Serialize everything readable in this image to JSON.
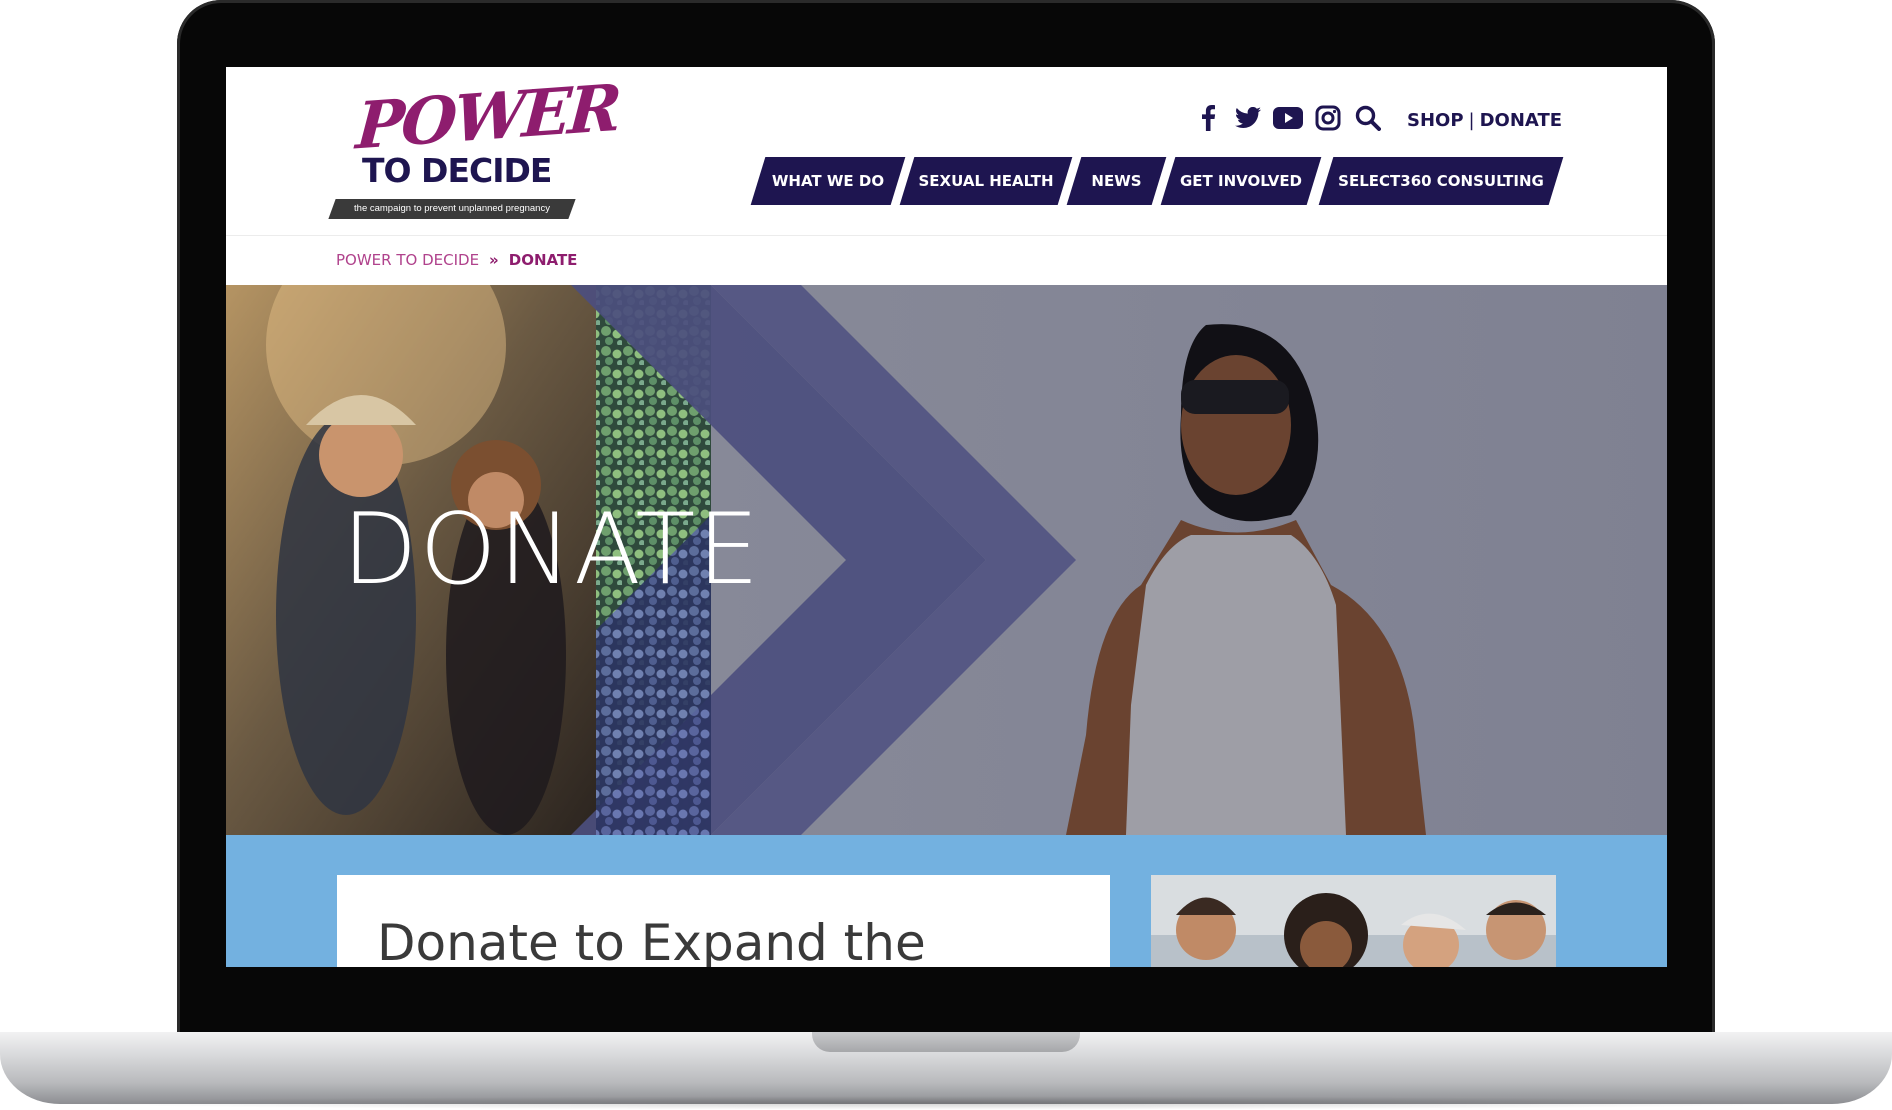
{
  "logo": {
    "word1": "POWER",
    "word2": "TO DECIDE",
    "tagline": "the campaign to prevent unplanned pregnancy"
  },
  "social": [
    {
      "icon": "facebook-icon"
    },
    {
      "icon": "twitter-icon"
    },
    {
      "icon": "youtube-icon"
    },
    {
      "icon": "instagram-icon"
    },
    {
      "icon": "search-icon"
    }
  ],
  "utility": {
    "shop": "SHOP",
    "separator": "|",
    "donate": "DONATE"
  },
  "nav": [
    {
      "label": "WHAT WE DO"
    },
    {
      "label": "SEXUAL HEALTH"
    },
    {
      "label": "NEWS"
    },
    {
      "label": "GET INVOLVED"
    },
    {
      "label": "SELECT360 CONSULTING"
    }
  ],
  "breadcrumb": {
    "home": "POWER TO DECIDE",
    "separator": "»",
    "current": "DONATE"
  },
  "hero": {
    "title": "DONATE"
  },
  "card": {
    "title": "Donate to Expand the"
  },
  "colors": {
    "brand_purple": "#1e1550",
    "brand_magenta": "#8e1d6e",
    "band_blue": "#73b1e0",
    "hero_chevron": "#4c4e7e"
  }
}
